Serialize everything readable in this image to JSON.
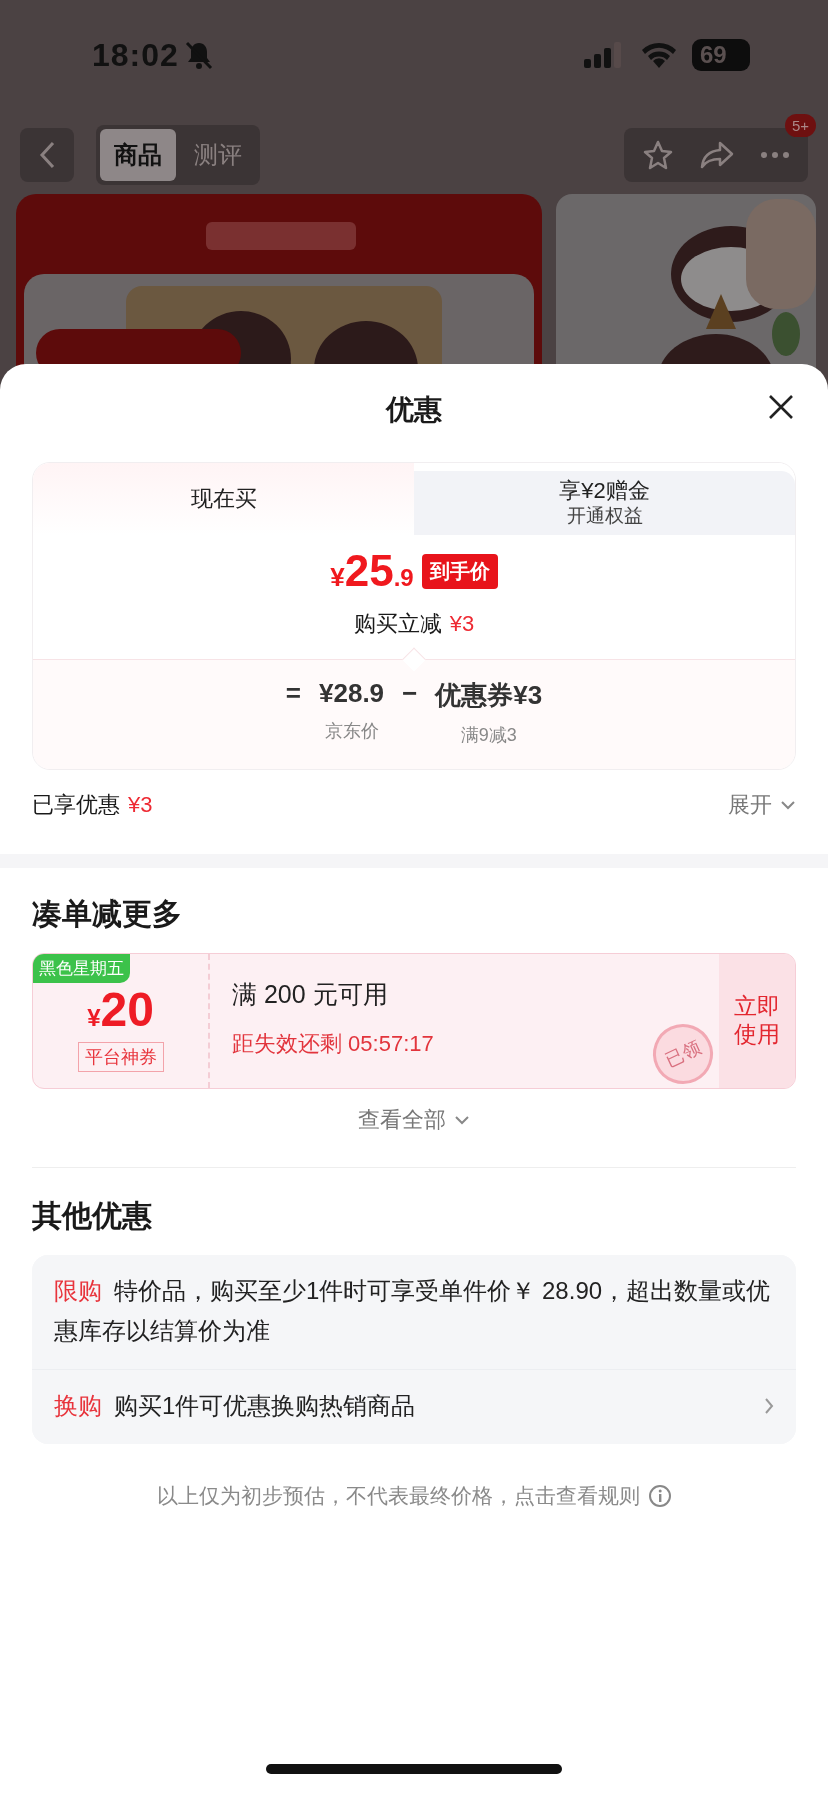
{
  "status_bar": {
    "time": "18:02",
    "battery": "69"
  },
  "nav": {
    "tabs": [
      {
        "label": "商品",
        "selected": true
      },
      {
        "label": "测评",
        "selected": false
      }
    ],
    "badge": "5+"
  },
  "sheet": {
    "title": "优惠",
    "price_tabs": [
      {
        "label": "现在买",
        "selected": true
      },
      {
        "label": "享¥2赠金",
        "sublabel": "开通权益",
        "selected": false
      }
    ],
    "price": "¥25.9",
    "price_tag": "到手价",
    "instant_label": "购买立减",
    "instant_amount": "¥3",
    "formula": [
      {
        "kind": "operator",
        "text": "="
      },
      {
        "kind": "term",
        "text": "¥28.9",
        "caption": "京东价"
      },
      {
        "kind": "operator",
        "text": "−"
      },
      {
        "kind": "term",
        "text": "优惠券¥3",
        "caption": "满9减3"
      }
    ],
    "enjoyed_label": "已享优惠",
    "enjoyed_amount": "¥3",
    "expand": "展开"
  },
  "bundle": {
    "title": "凑单减更多",
    "coupons": [
      {
        "tag": "黑色星期五",
        "amount": "¥20",
        "type": "平台神券",
        "condition": "满 200 元可用",
        "countdown": "距失效还剩 05:57:17",
        "action": "立即使用",
        "stamp": "已领"
      }
    ],
    "view_all": "查看全部"
  },
  "other": {
    "title": "其他优惠",
    "items": [
      {
        "label": "限购",
        "text": "特价品，购买至少1件时可享受单件价￥ 28.90，超出数量或优惠库存以结算价为准",
        "has_arrow": false
      },
      {
        "label": "换购",
        "text": "购买1件可优惠换购热销商品",
        "has_arrow": true
      }
    ]
  },
  "footnote": "以上仅为初步预估，不代表最终价格，点击查看规则"
}
